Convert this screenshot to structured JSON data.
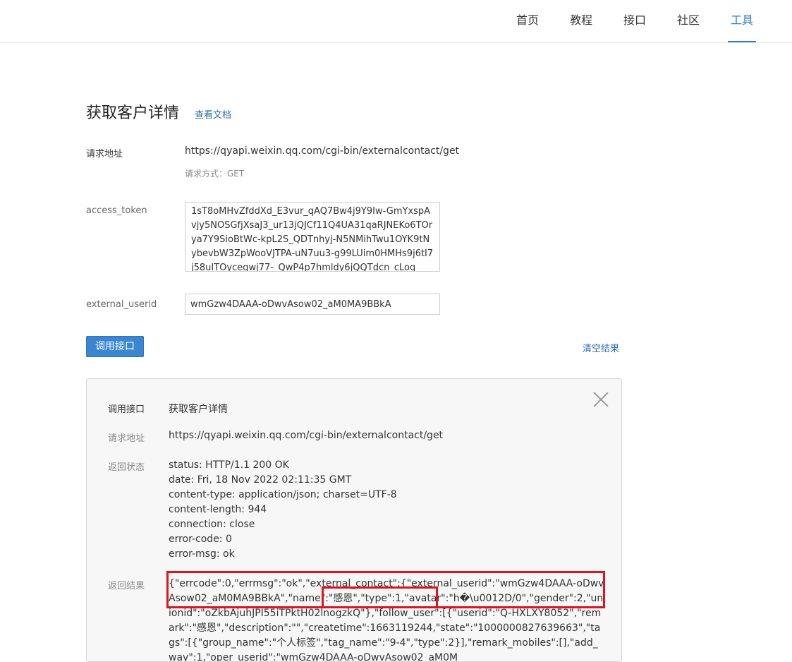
{
  "nav": {
    "items": [
      "首页",
      "教程",
      "接口",
      "社区",
      "工具"
    ],
    "active": "工具"
  },
  "page": {
    "title": "获取客户详情",
    "doc_link": "查看文档"
  },
  "form": {
    "request_url_label": "请求地址",
    "request_url": "https://qyapi.weixin.qq.com/cgi-bin/externalcontact/get",
    "method_text": "请求方式：GET",
    "access_token_label": "access_token",
    "access_token": "1sT8oMHvZfddXd_E3vur_qAQ7Bw4j9Y9Iw-GmYxspAvjy5NOSGfjXsaJ3_ur13jQJCf11Q4UA31qaRJNEKo6TOrya7Y9SioBtWc-kpL2S_QDTnhyj-N5NMihTwu1OYK9tNybevbW3ZpWooVJTPA-uN7uu3-g99LUim0HMHs9j6tI7j58uITOycegwj77-_QwP4p7hmldy6jQQTdcn_cLog",
    "external_userid_label": "external_userid",
    "external_userid": "wmGzw4DAAA-oDwvAsow02_aM0MA9BBkA",
    "call_button": "调用接口",
    "clear_link": "清空结果"
  },
  "result": {
    "api_label": "调用接口",
    "api_value": "获取客户详情",
    "url_label": "请求地址",
    "url_value": "https://qyapi.weixin.qq.com/cgi-bin/externalcontact/get",
    "status_label": "返回状态",
    "status_lines": [
      "status: HTTP/1.1 200 OK",
      "date: Fri, 18 Nov 2022 02:11:35 GMT",
      "content-type: application/json; charset=UTF-8",
      "content-length: 944",
      "connection: close",
      "error-code: 0",
      "error-msg: ok"
    ],
    "body_label": "返回结果",
    "body_text": "{\"errcode\":0,\"errmsg\":\"ok\",\"external_contact\":{\"external_userid\":\"wmGzw4DAAA-oDwvAsow02_aM0MA9BBkA\",\"name\":\"感恩\",\"type\":1,\"avatar\":\"h�\\u0012D/0\",\"gender\":2,\"unionid\":\"oZkbAjuhJPI55iTPktH02lnogzkQ\"},\"follow_user\":[{\"userid\":\"Q-HXLXY8052\",\"remark\":\"感恩\",\"description\":\"\",\"createtime\":1663119244,\"state\":\"1000000827639663\",\"tags\":[{\"group_name\":\"个人标签\",\"tag_name\":\"9-4\",\"type\":2}],\"remark_mobiles\":[],\"add_way\":1,\"oper_userid\":\"wmGzw4DAAA-oDwvAsow02_aM0M"
  },
  "colors": {
    "accent": "#2b7bd6",
    "button": "#3a86d1",
    "highlight": "#e0121b"
  }
}
